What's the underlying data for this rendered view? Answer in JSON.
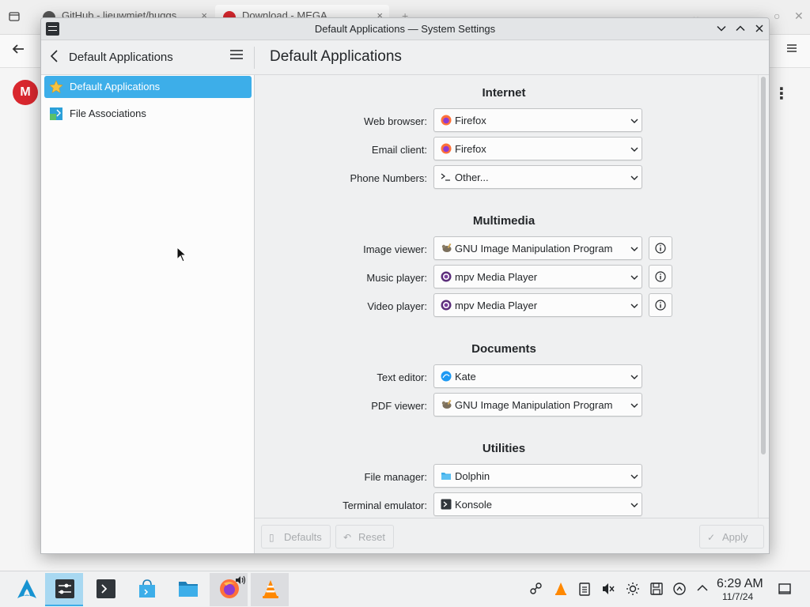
{
  "browser": {
    "tabs": [
      {
        "label": "GitHub - lieuwmiet/huggs"
      },
      {
        "label": "Download - MEGA"
      }
    ],
    "new_tab": "+",
    "mega_logo": "M",
    "colors": {
      "mega_red": "#d9272e",
      "firefox_orange": "#ff7139"
    }
  },
  "window": {
    "title": "Default Applications — System Settings",
    "sidebar_header": "Default Applications",
    "page_title": "Default Applications",
    "controls": {
      "minimize_icon": "chevron-down-icon",
      "maximize_icon": "chevron-up-icon",
      "close_icon": "close-icon"
    }
  },
  "sidebar": {
    "items": [
      {
        "label": "Default Applications",
        "icon": "star-icon",
        "selected": true
      },
      {
        "label": "File Associations",
        "icon": "file-associations-icon",
        "selected": false
      }
    ]
  },
  "sections": [
    {
      "title": "Internet",
      "rows": [
        {
          "label": "Web browser:",
          "value": "Firefox",
          "icon": "firefox-icon"
        },
        {
          "label": "Email client:",
          "value": "Firefox",
          "icon": "firefox-icon"
        },
        {
          "label": "Phone Numbers:",
          "value": "Other...",
          "icon": "terminal-prompt-icon"
        }
      ]
    },
    {
      "title": "Multimedia",
      "rows": [
        {
          "label": "Image viewer:",
          "value": "GNU Image Manipulation Program",
          "icon": "gimp-icon",
          "info": true
        },
        {
          "label": "Music player:",
          "value": "mpv Media Player",
          "icon": "mpv-icon",
          "info": true
        },
        {
          "label": "Video player:",
          "value": "mpv Media Player",
          "icon": "mpv-icon",
          "info": true
        }
      ]
    },
    {
      "title": "Documents",
      "rows": [
        {
          "label": "Text editor:",
          "value": "Kate",
          "icon": "kate-icon"
        },
        {
          "label": "PDF viewer:",
          "value": "GNU Image Manipulation Program",
          "icon": "gimp-icon"
        }
      ]
    },
    {
      "title": "Utilities",
      "rows": [
        {
          "label": "File manager:",
          "value": "Dolphin",
          "icon": "dolphin-folder-icon"
        },
        {
          "label": "Terminal emulator:",
          "value": "Konsole",
          "icon": "konsole-icon"
        }
      ]
    }
  ],
  "footer": {
    "defaults_label": "Defaults",
    "reset_label": "Reset",
    "apply_label": "Apply",
    "enabled": false
  },
  "taskbar": {
    "apps": [
      {
        "name": "application-launcher",
        "icon": "arch-logo-icon"
      },
      {
        "name": "system-settings",
        "icon": "settings-sliders-icon",
        "active": true
      },
      {
        "name": "konsole",
        "icon": "terminal-icon"
      },
      {
        "name": "discover",
        "icon": "discover-store-icon"
      },
      {
        "name": "dolphin",
        "icon": "folder-icon"
      },
      {
        "name": "firefox",
        "icon": "firefox-icon",
        "audio": true
      },
      {
        "name": "vlc",
        "icon": "vlc-cone-icon"
      }
    ],
    "tray": [
      "network-icon",
      "vlc-tray-icon",
      "clipboard-icon",
      "volume-muted-icon",
      "brightness-icon",
      "save-disk-icon",
      "updates-icon",
      "expand-tray-icon"
    ],
    "clock": {
      "time": "6:29 AM",
      "date": "11/7/24"
    },
    "show_desktop_icon": "show-desktop-icon"
  }
}
